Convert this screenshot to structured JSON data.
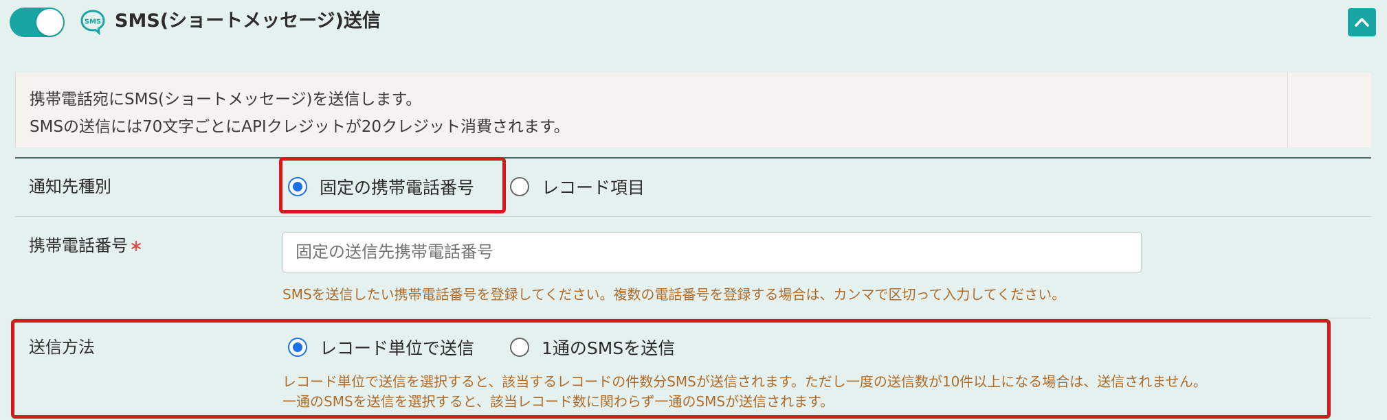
{
  "header": {
    "toggle_on": true,
    "icon": "sms-chat-bubble-icon",
    "icon_text": "SMS",
    "title": "SMS(ショートメッセージ)送信",
    "collapse_icon": "chevron-up-icon"
  },
  "description": {
    "line1": "携帯電話宛にSMS(ショートメッセージ)を送信します。",
    "line2": "SMSの送信には70文字ごとにAPIクレジットが20クレジット消費されます。"
  },
  "notify_type": {
    "label": "通知先種別",
    "options": [
      {
        "label": "固定の携帯電話番号",
        "checked": true
      },
      {
        "label": "レコード項目",
        "checked": false
      }
    ]
  },
  "phone": {
    "label": "携帯電話番号",
    "required_mark": "∗",
    "placeholder": "固定の送信先携帯電話番号",
    "value": "",
    "help": "SMSを送信したい携帯電話番号を登録してください。複数の電話番号を登録する場合は、カンマで区切って入力してください。"
  },
  "send_method": {
    "label": "送信方法",
    "options": [
      {
        "label": "レコード単位で送信",
        "checked": true
      },
      {
        "label": "1通のSMSを送信",
        "checked": false
      }
    ],
    "help1": "レコード単位で送信を選択すると、該当するレコードの件数分SMSが送信されます。ただし一度の送信数が10件以上になる場合は、送信されません。",
    "help2": "一通のSMSを送信を選択すると、該当レコード数に関わらず一通のSMSが送信されます。"
  },
  "colors": {
    "accent": "#1aa5a5",
    "radio_checked": "#1a73e8",
    "help_text": "#b06c2a",
    "highlight": "#d9161c"
  }
}
